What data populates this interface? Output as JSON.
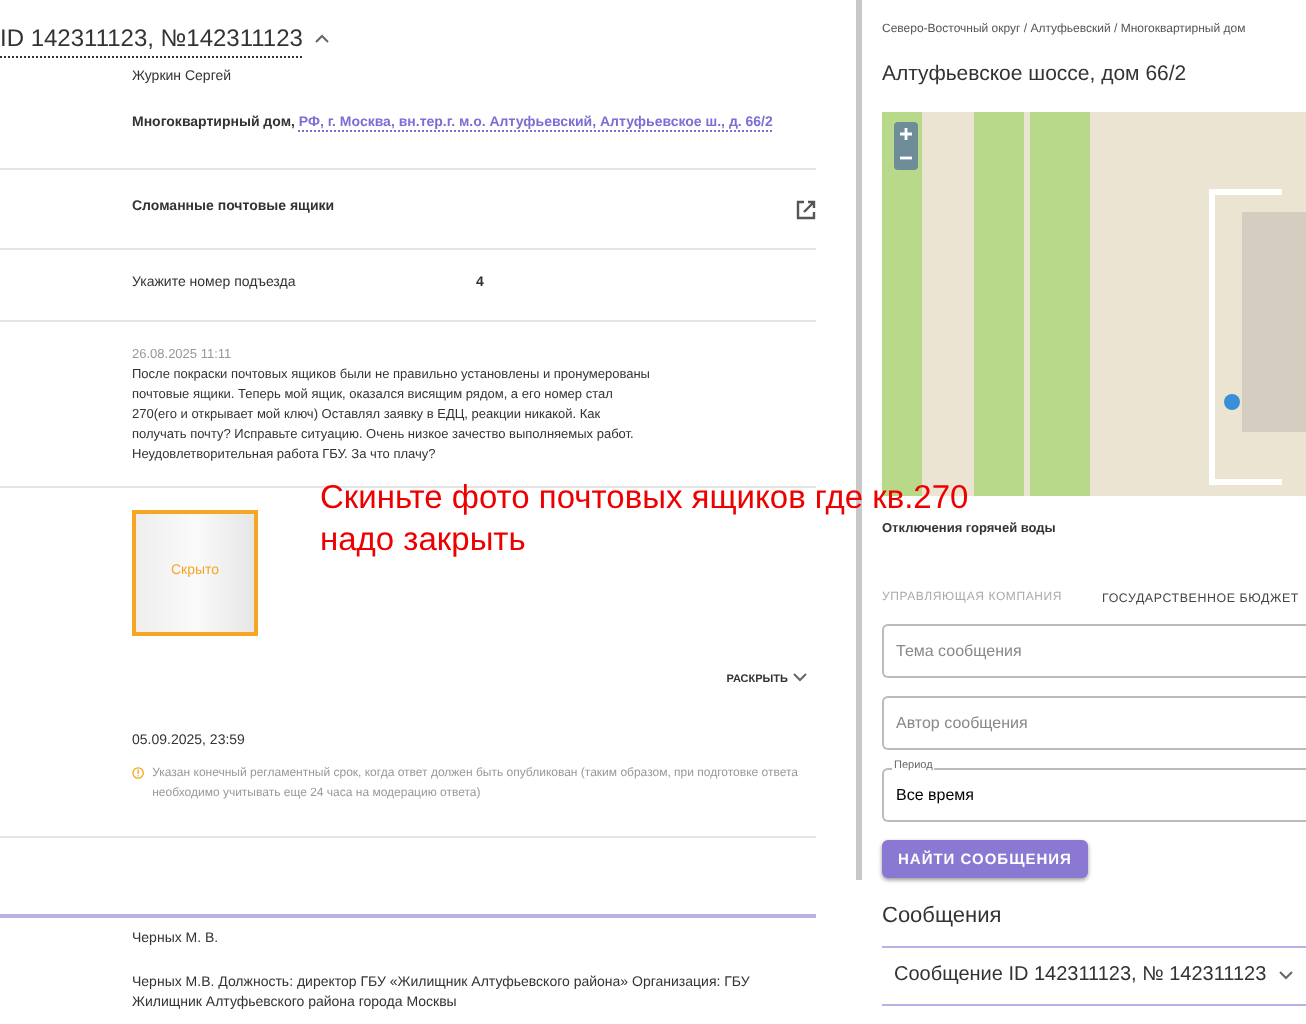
{
  "header": {
    "title": "ID 142311123, №142311123",
    "expanded": true
  },
  "author": "Журкин Сергей",
  "object": {
    "type_label": "Многоквартирный дом,",
    "address": "РФ, г. Москва, вн.тер.г. м.о. Алтуфьевский, Алтуфьевское ш., д. 66/2"
  },
  "topic": "Сломанные почтовые ящики",
  "entrance": {
    "label": "Укажите номер подъезда",
    "value": "4"
  },
  "message": {
    "date": "26.08.2025 11:11",
    "text": "После покраски почтовых ящиков были не правильно установлены и пронумерованы почтовые ящики. Теперь мой ящик, оказался висящим рядом, а его номер стал 270(его и открывает мой ключ) Оставлял заявку в ЕДЦ, реакции никакой. Как получать почту? Исправьте ситуацию. Очень низкое зачество выполняемых работ. Неудовлетворительная работа ГБУ. За что плачу?"
  },
  "attachment": {
    "caption": "Скрыто"
  },
  "expand_link": "РАСКРЫТЬ",
  "deadline": {
    "date": "05.09.2025, 23:59",
    "note": "Указан конечный регламентный срок, когда ответ должен быть опубликован (таким образом, при подготовке ответа необходимо учитывать еще 24 часа на модерацию ответа)"
  },
  "response": {
    "author": "Черных М. В.",
    "details": "Черных М.В. Должность: директор ГБУ «Жилищник Алтуфьевского района» Организация: ГБУ Жилищник Алтуфьевского района города Москвы"
  },
  "annotation": {
    "lines": [
      "Скиньте фото почтовых ящиков где кв.270",
      "надо закрыть"
    ]
  },
  "sidebar": {
    "breadcrumb": "Северо-Восточный округ / Алтуфьевский / Многоквартирный дом",
    "title": "Алтуфьевское шоссе, дом 66/2",
    "section": "Отключения горячей воды",
    "tabs": [
      {
        "label": "УПРАВЛЯЮЩАЯ КОМПАНИЯ",
        "selected": false
      },
      {
        "label": "ГОСУДАРСТВЕННОЕ БЮДЖЕТ",
        "selected": true
      }
    ],
    "fields": [
      {
        "placeholder": "Тема сообщения"
      },
      {
        "placeholder": "Автор сообщения"
      },
      {
        "label": "Период",
        "value": "Все время"
      }
    ],
    "search_button": "НАЙТИ СООБЩЕНИЯ",
    "messages_heading": "Сообщения",
    "messages": [
      {
        "title": "Сообщение ID 142311123, № 142311123",
        "expanded": false
      }
    ]
  }
}
